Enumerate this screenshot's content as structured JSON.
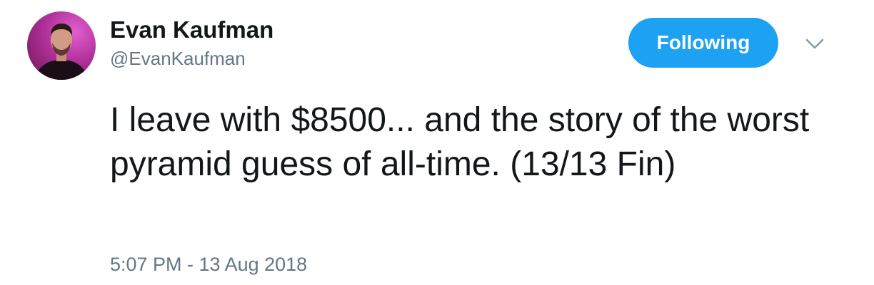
{
  "tweet": {
    "author": {
      "name": "Evan Kaufman",
      "handle": "@EvanKaufman"
    },
    "follow_button_label": "Following",
    "follow_button_color": "#1da1f2",
    "text": "I leave with $8500... and the story of the worst pyramid guess of all-time. (13/13 Fin)",
    "timestamp": "5:07 PM - 13 Aug 2018",
    "icons": {
      "avatar": "profile-photo",
      "menu": "chevron-down-icon"
    }
  }
}
